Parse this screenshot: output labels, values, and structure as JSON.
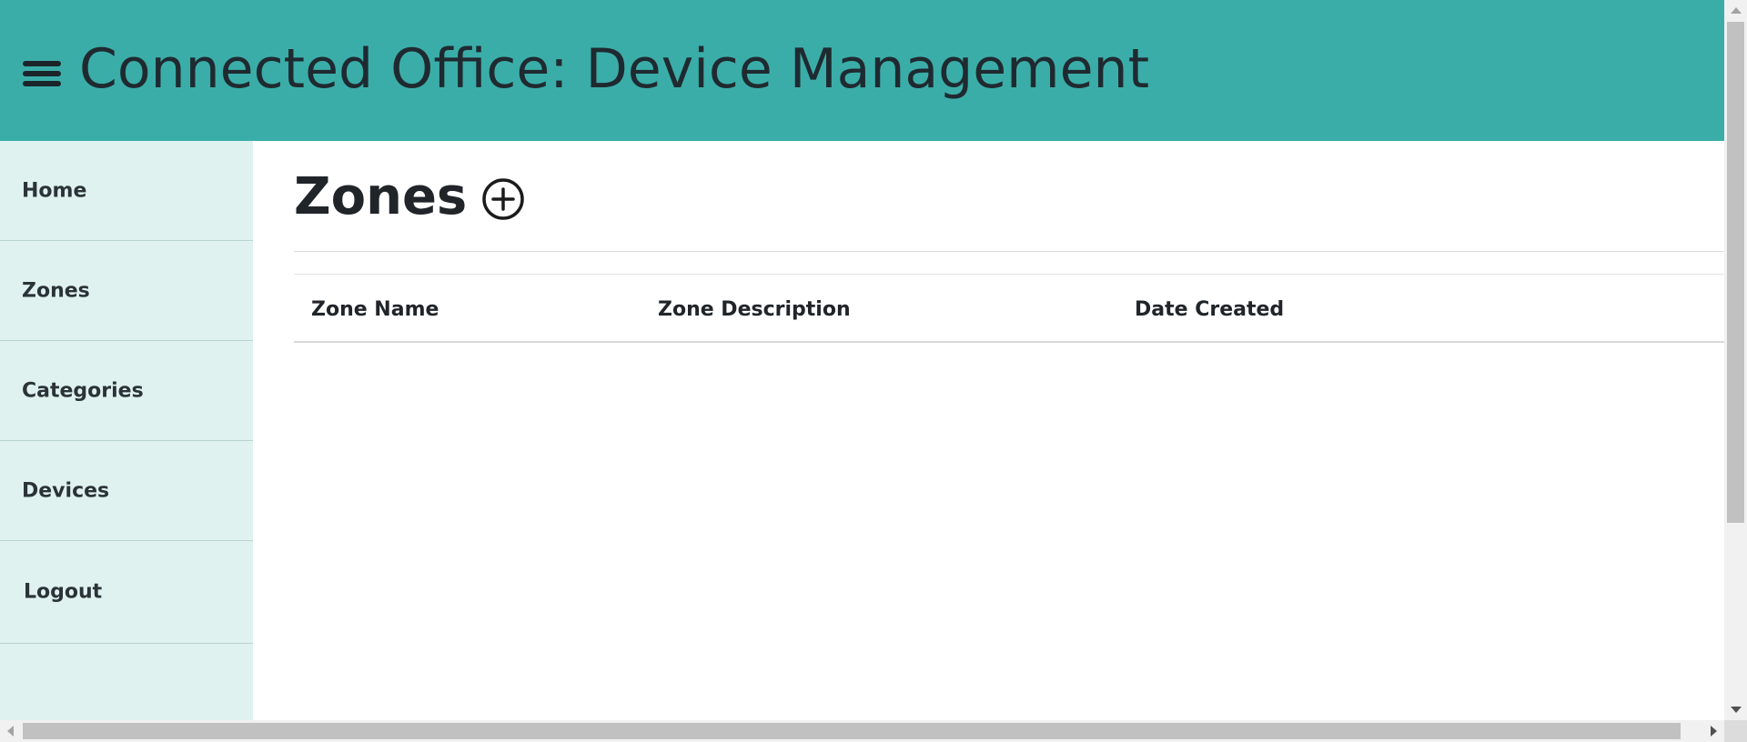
{
  "header": {
    "title": "Connected Office: Device Management",
    "menu_icon": "hamburger-menu-icon",
    "background_color": "#3bada9"
  },
  "sidebar": {
    "background_color": "#dff2f0",
    "items": [
      {
        "label": "Home"
      },
      {
        "label": "Zones"
      },
      {
        "label": "Categories"
      },
      {
        "label": "Devices"
      },
      {
        "label": "Logout"
      }
    ]
  },
  "main": {
    "title": "Zones",
    "add_icon": "plus-circle-icon",
    "table": {
      "columns": [
        "Zone Name",
        "Zone Description",
        "Date Created"
      ],
      "rows": []
    }
  }
}
